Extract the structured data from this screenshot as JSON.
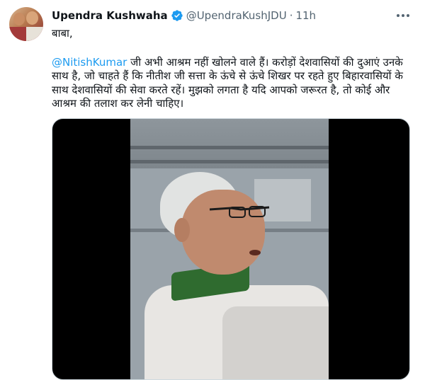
{
  "tweet": {
    "author_name": "Upendra Kushwaha",
    "handle": "@UpendraKushJDU",
    "separator": "·",
    "time": "11h",
    "line1": "बाबा,",
    "mention": "@NitishKumar",
    "body_text": " जी अभी आश्रम नहीं खोलने वाले हैं। करोड़ों देशवासियों की दुआएं उनके साथ है, जो चाहते हैं कि नीतीश जी सत्ता के ऊंचे से ऊंचे शिखर पर रहते हुए बिहारवासियों के साथ देशवासियों की सेवा करते रहें। मुझको लगता है यदि आपको जरूरत है, तो कोई और आश्रम की तलाश कर लेनी चाहिए।"
  },
  "icons": {
    "verified": "verified-badge-icon",
    "more": "more-options-icon"
  },
  "colors": {
    "link": "#1d9bf0",
    "secondary_text": "#536471",
    "primary_text": "#0f1419",
    "verified": "#1d9bf0"
  }
}
